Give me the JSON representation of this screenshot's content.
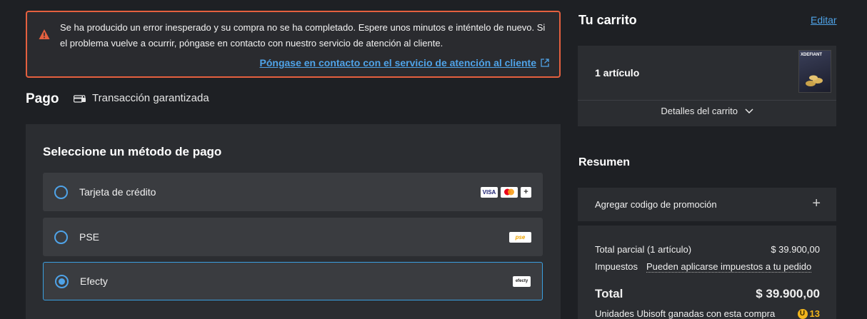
{
  "alert": {
    "message": "Se ha producido un error inesperado y su compra no se ha completado. Espere unos minutos e inténtelo de nuevo. Si el problema vuelve a ocurrir, póngase en contacto con nuestro servicio de atención al cliente.",
    "link_label": "Póngase en contacto con el servicio de atención al cliente",
    "icon": "warning-icon",
    "accent_color": "#e5603f"
  },
  "payment": {
    "title": "Pago",
    "guarantee_label": "Transacción garantizada",
    "heading": "Seleccione un método de pago",
    "methods": [
      {
        "label": "Tarjeta de crédito",
        "selected": false,
        "logos": [
          "VISA",
          "mastercard",
          "+"
        ]
      },
      {
        "label": "PSE",
        "selected": false,
        "logos": [
          "pse"
        ]
      },
      {
        "label": "Efecty",
        "selected": true,
        "logos": [
          "efecty"
        ]
      }
    ]
  },
  "cart": {
    "title": "Tu carrito",
    "edit_label": "Editar",
    "item_count": "1 artículo",
    "details_label": "Detalles del carrito",
    "thumb_label": "XDEFIANT"
  },
  "summary": {
    "title": "Resumen",
    "promo_label": "Agregar codigo de promoción",
    "subtotal_label": "Total parcial (1 artículo)",
    "subtotal_value": "$ 39.900,00",
    "tax_label": "Impuestos",
    "tax_value": "Pueden aplicarse impuestos a tu pedido",
    "total_label": "Total",
    "total_value": "$ 39.900,00",
    "units_label": "Unidades Ubisoft ganadas con esta compra",
    "units_value": "13"
  },
  "colors": {
    "link": "#4fa3e8",
    "panel": "#2b2d31",
    "background": "#1e2024"
  }
}
